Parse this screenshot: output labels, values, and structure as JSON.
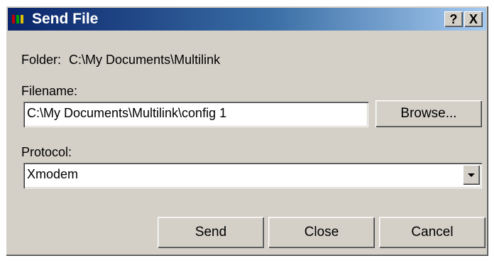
{
  "window": {
    "title": "Send File",
    "help_label": "?",
    "close_label": "X",
    "icon_colors": [
      "#c00000",
      "#00a000",
      "#e0c000"
    ]
  },
  "folder": {
    "label": "Folder:",
    "value": "C:\\My Documents\\Multilink"
  },
  "filename": {
    "label": "Filename:",
    "value": "C:\\My Documents\\Multilink\\config 1"
  },
  "browse_label": "Browse...",
  "protocol": {
    "label": "Protocol:",
    "selected": "Xmodem"
  },
  "buttons": {
    "send": "Send",
    "close": "Close",
    "cancel": "Cancel"
  }
}
